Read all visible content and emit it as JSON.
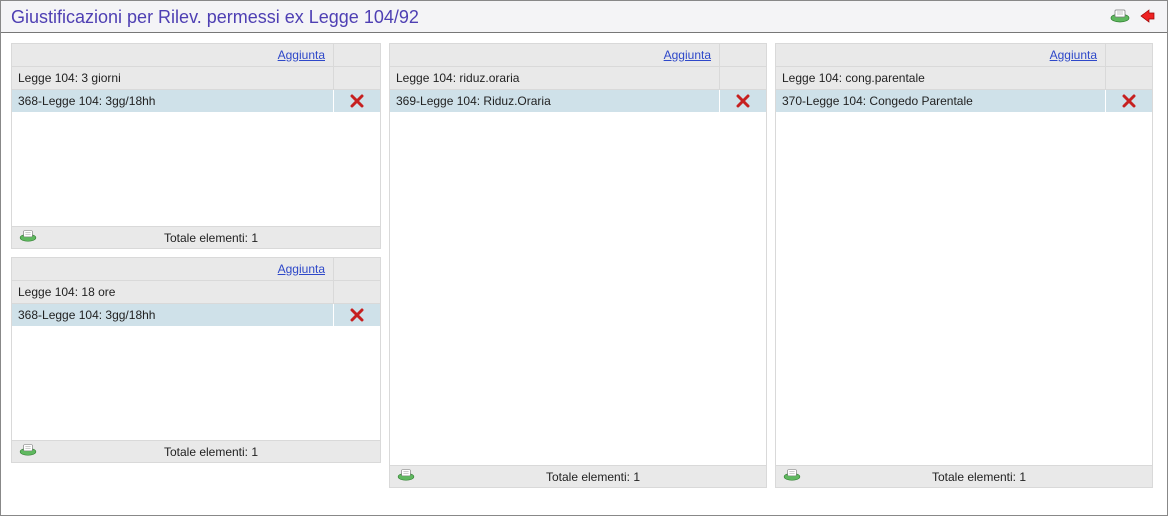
{
  "header": {
    "title": "Giustificazioni per Rilev. permessi ex Legge 104/92"
  },
  "labels": {
    "aggiunta": "Aggiunta"
  },
  "panels": [
    {
      "subheader": "Legge 104: 3 giorni",
      "row": "368-Legge 104: 3gg/18hh",
      "footer": "Totale elementi: 1"
    },
    {
      "subheader": "Legge 104: 18 ore",
      "row": "368-Legge 104: 3gg/18hh",
      "footer": "Totale elementi: 1"
    },
    {
      "subheader": "Legge 104: riduz.oraria",
      "row": "369-Legge 104: Riduz.Oraria",
      "footer": "Totale elementi: 1"
    },
    {
      "subheader": "Legge 104: cong.parentale",
      "row": "370-Legge 104: Congedo Parentale",
      "footer": "Totale elementi: 1"
    }
  ]
}
